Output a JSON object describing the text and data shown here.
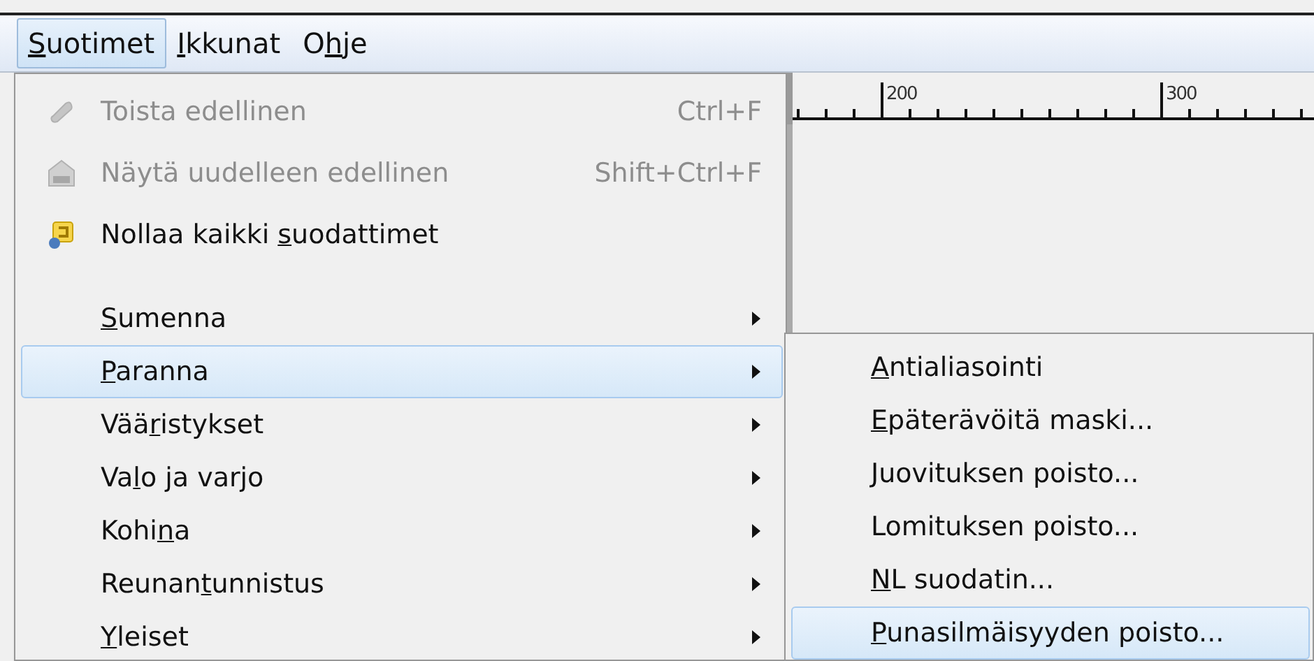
{
  "menubar": [
    {
      "access_key": "S",
      "label_end": "uotimet",
      "selected": true
    },
    {
      "access_key": "I",
      "label_end": "kkunat",
      "selected": false
    },
    {
      "label_start": "O",
      "access_key": "h",
      "label_end": "je",
      "selected": false
    }
  ],
  "ruler": {
    "labels": [
      "200",
      "300"
    ]
  },
  "filters_menu": {
    "items": [
      {
        "kind": "command",
        "label": "Toista edellinen",
        "shortcut": "Ctrl+F",
        "disabled": true,
        "selected": false
      },
      {
        "kind": "command",
        "label": "Näytä uudelleen edellinen",
        "shortcut": "Shift+Ctrl+F",
        "disabled": true,
        "selected": false
      },
      {
        "kind": "command",
        "label_start": "Nollaa kaikki ",
        "access_key": "s",
        "label_end": "uodattimet",
        "disabled": false,
        "selected": false
      },
      {
        "kind": "separator"
      },
      {
        "kind": "submenu",
        "access_key": "S",
        "label_end": "umenna",
        "disabled": false,
        "selected": false
      },
      {
        "kind": "submenu",
        "access_key": "P",
        "label_end": "aranna",
        "disabled": false,
        "selected": true
      },
      {
        "kind": "submenu",
        "label_start": "Vää",
        "access_key": "r",
        "label_end": "istykset",
        "disabled": false,
        "selected": false
      },
      {
        "kind": "submenu",
        "label_start": "Va",
        "access_key": "l",
        "label_end": "o ja varjo",
        "disabled": false,
        "selected": false
      },
      {
        "kind": "submenu",
        "label_start": "Kohi",
        "access_key": "n",
        "label_end": "a",
        "disabled": false,
        "selected": false
      },
      {
        "kind": "submenu",
        "label_start": "Reunan",
        "access_key": "t",
        "label_end": "unnistus",
        "disabled": false,
        "selected": false
      },
      {
        "kind": "submenu",
        "access_key": "Y",
        "label_end": "leiset",
        "disabled": false,
        "selected": false
      }
    ]
  },
  "enhance_submenu": {
    "items": [
      {
        "kind": "command",
        "access_key": "A",
        "label_end": "ntialiasointi",
        "selected": false
      },
      {
        "kind": "command",
        "access_key": "E",
        "label_end": "päterävöitä maski...",
        "selected": false
      },
      {
        "kind": "command",
        "label": "Juovituksen poisto...",
        "selected": false
      },
      {
        "kind": "command",
        "label": "Lomituksen poisto...",
        "selected": false
      },
      {
        "kind": "command",
        "access_key": "N",
        "label_end": "L suodatin...",
        "selected": false
      },
      {
        "kind": "command",
        "access_key": "P",
        "label_end": "unasilmäisyyden poisto...",
        "selected": true
      }
    ]
  }
}
